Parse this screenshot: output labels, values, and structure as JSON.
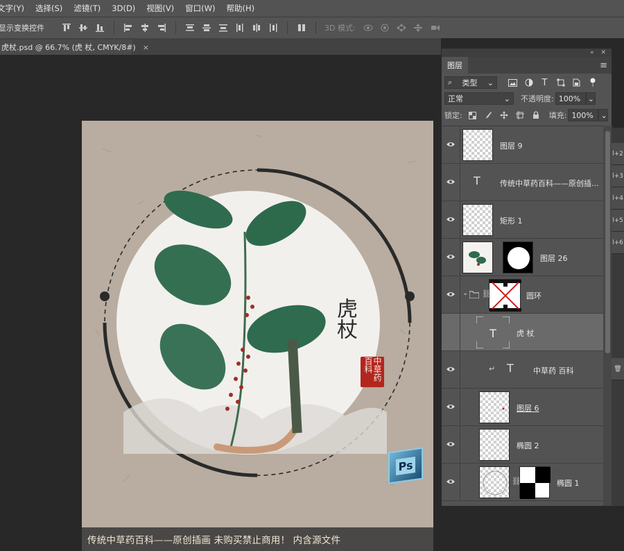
{
  "menu": [
    "文字(Y)",
    "选择(S)",
    "滤镜(T)",
    "3D(D)",
    "视图(V)",
    "窗口(W)",
    "帮助(H)"
  ],
  "options": {
    "transform_label": "显示变换控件",
    "mode_3d_label": "3D 模式:"
  },
  "document_tab": {
    "title": "虎杖.psd @ 66.7% (虎 杖, CMYK/8#)",
    "close": "×"
  },
  "artwork": {
    "title": "虎杖",
    "seal": "中草药百科",
    "footer": "传统中草药百科——原创插画 未购买禁止商用！ 内含源文件",
    "ps_badge": "Ps"
  },
  "layers_panel": {
    "tab": "图层",
    "filter_label": "类型",
    "blend_mode": "正常",
    "opacity_label": "不透明度:",
    "opacity_value": "100%",
    "lock_label": "锁定:",
    "fill_label": "填充:",
    "fill_value": "100%",
    "layers": [
      {
        "name": "图层 9",
        "kind": "pixel"
      },
      {
        "name": "传统中草药百科——原创插...",
        "kind": "text"
      },
      {
        "name": "矩形 1",
        "kind": "shape"
      },
      {
        "name": "图层 26",
        "kind": "pixel-mask"
      },
      {
        "name": "圆环",
        "kind": "group"
      },
      {
        "name": "虎 杖",
        "kind": "text",
        "selected": true
      },
      {
        "name": "中草药  百科",
        "kind": "text-clipped"
      },
      {
        "name": "图层 6",
        "kind": "pixel"
      },
      {
        "name": "椭圆 2",
        "kind": "shape"
      },
      {
        "name": "椭圆 1",
        "kind": "shape-mask"
      }
    ]
  },
  "right_strip": [
    "l+2",
    "l+3",
    "l+4",
    "l+5",
    "l+6"
  ],
  "colors": {
    "accent_red": "#b3261e",
    "leaf_green": "#2f6b4f",
    "paper": "#b8ada0"
  }
}
